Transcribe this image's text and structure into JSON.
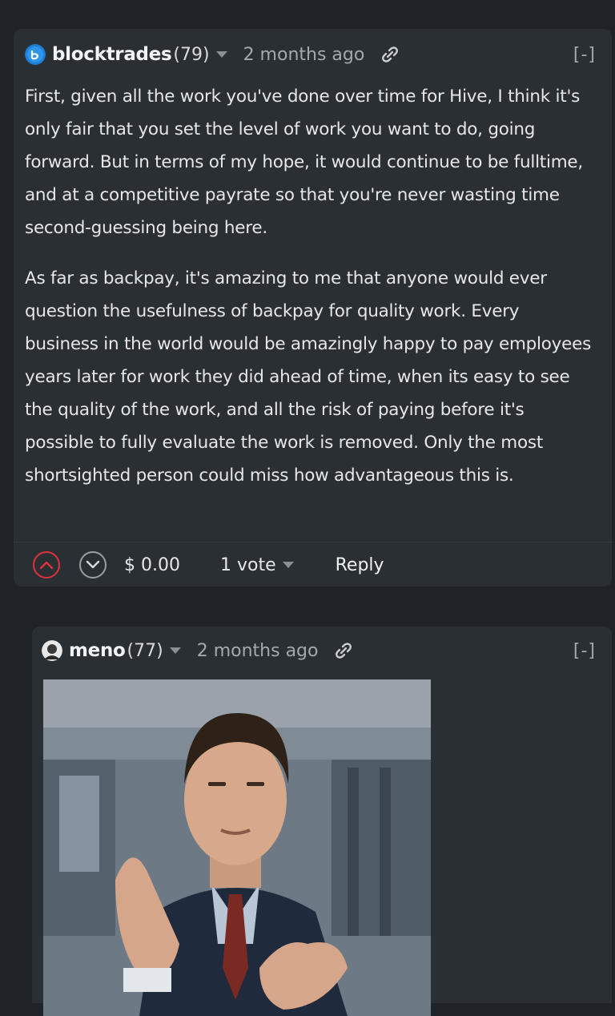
{
  "comments": [
    {
      "author": "blocktrades",
      "reputation": "(79)",
      "time": "2 months ago",
      "collapse": "[-]",
      "paragraphs": [
        "First, given all the work you've done over time for Hive, I think it's only fair that you set the level of work you want to do, going forward. But in terms of my hope, it would continue to be fulltime, and at a competitive payrate so that you're never wasting time second-guessing being here.",
        "As far as backpay, it's amazing to me that anyone would ever question the usefulness of backpay for quality work. Every business in the world would be amazingly happy to pay employees years later for work they did ahead of time, when its easy to see the quality of the work, and all the risk of paying before it's possible to fully evaluate the work is removed. Only the most shortsighted person could miss how advantageous this is."
      ],
      "payout": "$ 0.00",
      "votes": "1 vote",
      "reply": "Reply"
    },
    {
      "author": "meno",
      "reputation": "(77)",
      "time": "2 months ago",
      "collapse": "[-]"
    }
  ],
  "colors": {
    "upvote": "#e0313c",
    "background": "#1f2327",
    "card": "#2a2f34"
  }
}
